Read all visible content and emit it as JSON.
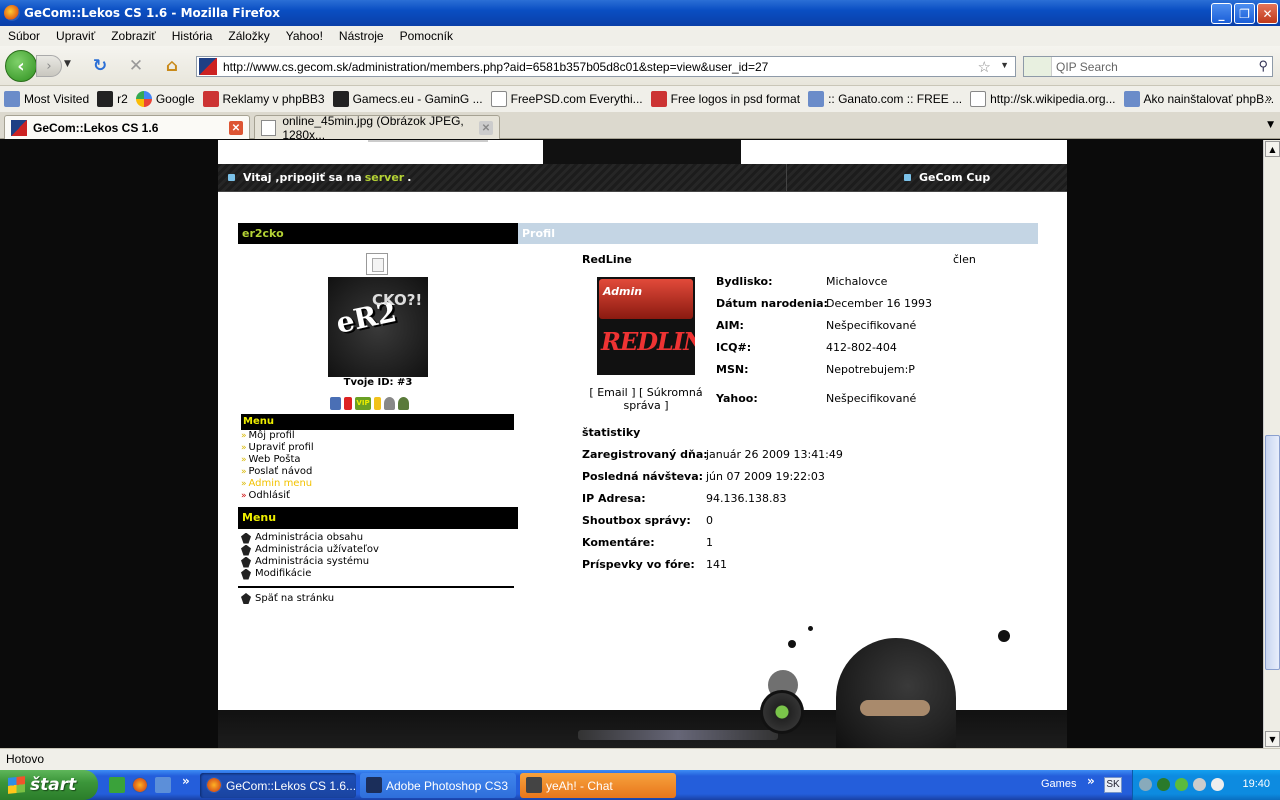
{
  "window": {
    "title": "GeCom::Lekos CS 1.6 - Mozilla Firefox"
  },
  "menubar": {
    "items": [
      "Súbor",
      "Upraviť",
      "Zobraziť",
      "História",
      "Záložky",
      "Yahoo!",
      "Nástroje",
      "Pomocník"
    ]
  },
  "nav": {
    "url": "http://www.cs.gecom.sk/administration/members.php?aid=6581b357b05d8c01&step=view&user_id=27",
    "search_placeholder": "QIP Search"
  },
  "bookmarks": [
    {
      "label": "Most Visited",
      "icon": "most-visited-icon"
    },
    {
      "label": "r2",
      "icon": "r2-icon"
    },
    {
      "label": "Google",
      "icon": "google-icon"
    },
    {
      "label": "Reklamy v phpBB3",
      "icon": "phpbb-icon"
    },
    {
      "label": "Gamecs.eu - GaminG ...",
      "icon": "gamecs-icon"
    },
    {
      "label": "FreePSD.com Everythi...",
      "icon": "page-icon"
    },
    {
      "label": "Free logos in psd format",
      "icon": "logos-icon"
    },
    {
      "label": ":: Ganato.com :: FREE ...",
      "icon": "ganato-icon"
    },
    {
      "label": "http://sk.wikipedia.org...",
      "icon": "wikipedia-icon"
    },
    {
      "label": "Ako nainštalovať phpB...",
      "icon": "phpbb-icon"
    }
  ],
  "tabs": [
    {
      "label": "GeCom::Lekos CS 1.6",
      "active": true
    },
    {
      "label": "online_45min.jpg (Obrázok JPEG, 1280x...",
      "active": false
    }
  ],
  "site": {
    "welcome_prefix": "Vitaj ,pripojiť sa na",
    "welcome_link": "server",
    "welcome_suffix": ".",
    "cup_link": "GeCom Cup",
    "username": "er2cko",
    "avatar_text": "eR2",
    "avatar_sub": "CKO?!",
    "profile_header": "Profil",
    "your_id": "Tvoje ID: #3",
    "menu_title": "Menu",
    "user_menu": [
      "Môj profil",
      "Upraviť profil",
      "Web Pošta",
      "Poslať návod",
      "Admin menu",
      "Odhlásiť"
    ],
    "admin_menu_title": "Menu",
    "admin_menu": [
      "Administrácia obsahu",
      "Administrácia užívateľov",
      "Administrácia systému",
      "Modifikácie"
    ],
    "back_link": "Späť na stránku"
  },
  "profile": {
    "name": "RedLine",
    "rank": "člen",
    "logo_admin": "Admin",
    "logo_text": "REDLINE",
    "links": "[ Email ] [ Súkromná správa ]",
    "fields": [
      {
        "label": "Bydlisko:",
        "value": "Michalovce"
      },
      {
        "label": "Dátum narodenia:",
        "value": "December 16 1993"
      },
      {
        "label": "AIM:",
        "value": "Nešpecifikované"
      },
      {
        "label": "ICQ#:",
        "value": "412-802-404"
      },
      {
        "label": "MSN:",
        "value": "Nepotrebujem:P"
      },
      {
        "label": "Yahoo:",
        "value": "Nešpecifikované"
      }
    ],
    "stats_title": "štatistiky",
    "stats": [
      {
        "label": "Zaregistrovaný dňa:",
        "value": "január 26 2009 13:41:49"
      },
      {
        "label": "Posledná návšteva:",
        "value": "jún 07 2009 19:22:03"
      },
      {
        "label": "IP Adresa:",
        "value": "94.136.138.83"
      },
      {
        "label": "Shoutbox správy:",
        "value": "0"
      },
      {
        "label": "Komentáre:",
        "value": "1"
      },
      {
        "label": "Príspevky vo fóre:",
        "value": "141"
      }
    ]
  },
  "status": {
    "text": "Hotovo"
  },
  "taskbar": {
    "start": "štart",
    "tasks": [
      "GeCom::Lekos CS 1.6...",
      "Adobe Photoshop CS3",
      "yeAh! - Chat"
    ],
    "games": "Games",
    "lang": "SK",
    "clock": "19:40"
  }
}
